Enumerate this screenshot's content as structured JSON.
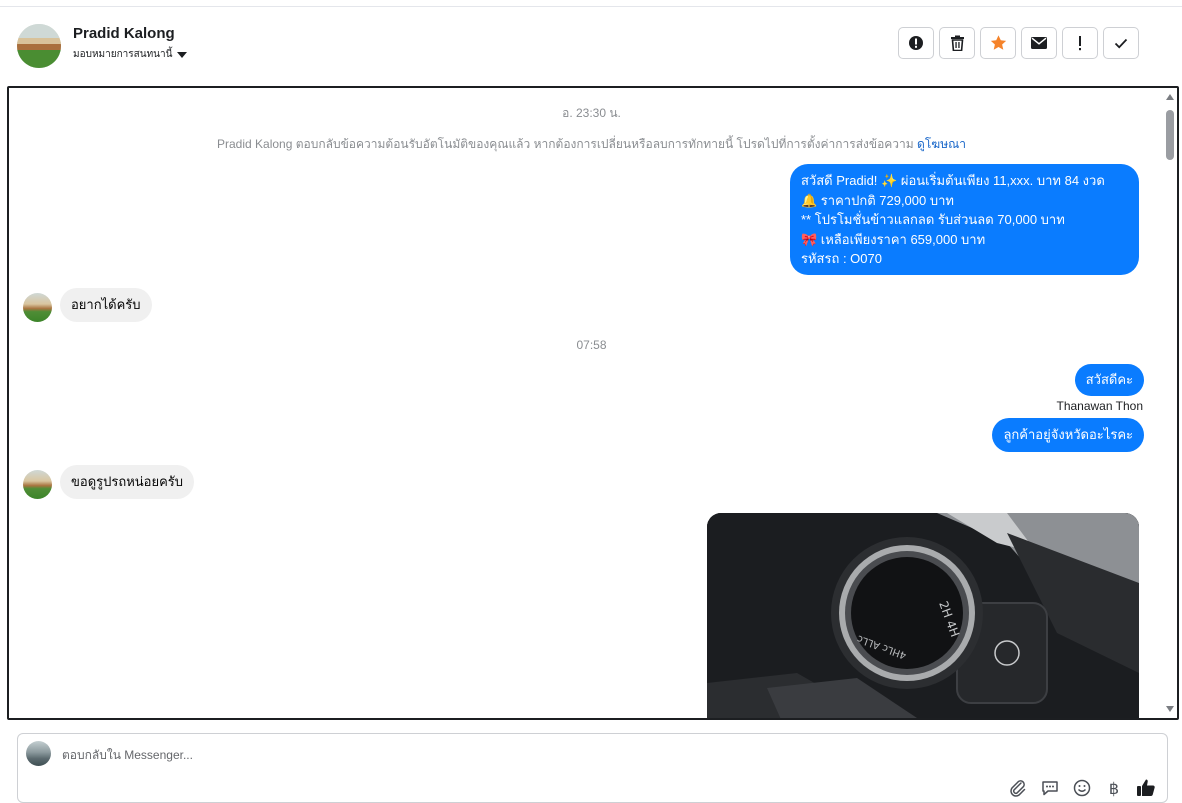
{
  "contact": {
    "name": "Pradid Kalong",
    "assign_label": "มอบหมายการสนทนานี้"
  },
  "actions": [
    {
      "name": "spam-alert",
      "icon": "alert-circle-icon"
    },
    {
      "name": "delete",
      "icon": "trash-icon"
    },
    {
      "name": "star",
      "icon": "star-icon"
    },
    {
      "name": "mark-unread",
      "icon": "envelope-icon"
    },
    {
      "name": "follow-up",
      "icon": "exclamation-icon"
    },
    {
      "name": "done",
      "icon": "checkmark-icon"
    }
  ],
  "chat": {
    "timestamp_1": "อ. 23:30 น.",
    "system_message": "Pradid Kalong ตอบกลับข้อความต้อนรับอัตโนมัติของคุณแล้ว หากต้องการเปลี่ยนหรือลบการทักทายนี้ โปรดไปที่การตั้งค่าการส่งข้อความ",
    "system_link": "ดูโฆษณา",
    "promo_lines": {
      "line1": "สวัสดี Pradid! ✨  ผ่อนเริ่มต้นเพียง 11,xxx. บาท 84 งวด",
      "line2": "🔔 ราคาปกติ 729,000 บาท",
      "line3": "** โปรโมชั่นข้าวแลกลด รับส่วนลด 70,000 บาท",
      "line4": "🎀  เหลือเพียงราคา 659,000 บาท",
      "line5": " รหัสรถ : O070"
    },
    "incoming_1": "อยากได้ครับ",
    "timestamp_2": "07:58",
    "outgoing_hello": "สวัสดีคะ",
    "sender_name": "Thanawan Thon",
    "outgoing_question": "ลูกค้าอยู่จังหวัดอะไรคะ",
    "incoming_2": "ขอดูรูปรถหน่อยครับ"
  },
  "composer": {
    "placeholder": "ตอบกลับใน Messenger..."
  },
  "colors": {
    "outgoing_bubble": "#0a7cff",
    "incoming_bubble": "#f0f0f0",
    "star_accent": "#f5832a",
    "link": "#1866c9"
  }
}
